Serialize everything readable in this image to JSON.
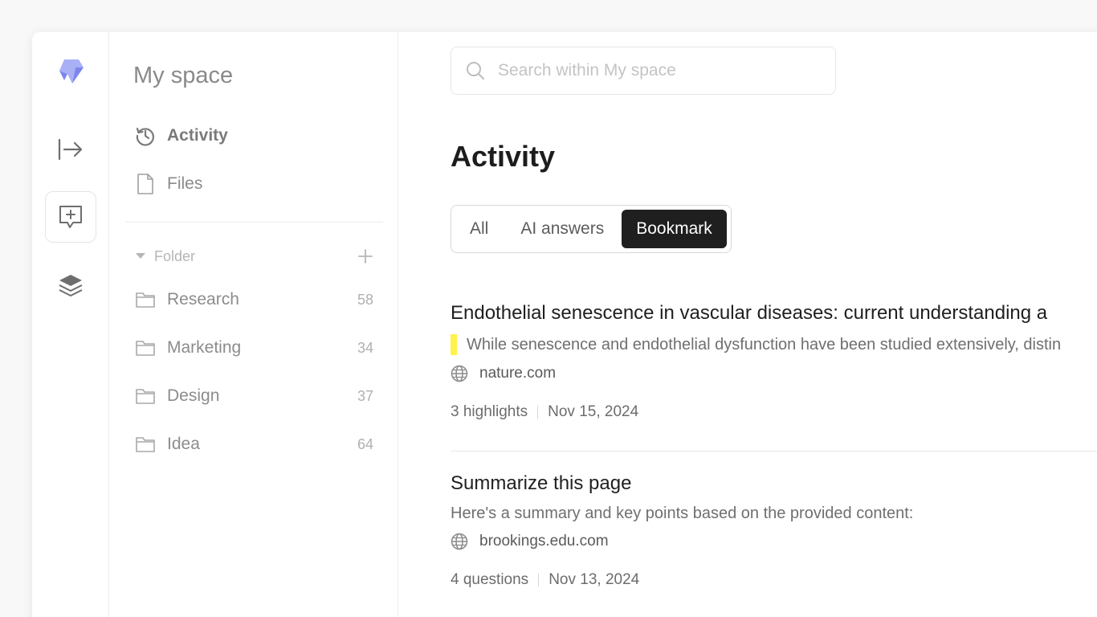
{
  "colors": {
    "accent": "#8d96f0",
    "highlight": "#fff24a",
    "tab_active_bg": "#1f1f1f"
  },
  "rail": {
    "items": [
      {
        "icon": "logo-icon"
      },
      {
        "icon": "expand-sidebar-icon"
      },
      {
        "icon": "new-chat-icon",
        "active": true
      },
      {
        "icon": "layers-icon"
      }
    ]
  },
  "sidebar": {
    "title": "My space",
    "nav": [
      {
        "label": "Activity",
        "icon": "history-icon",
        "active": true
      },
      {
        "label": "Files",
        "icon": "file-icon"
      }
    ],
    "folder_header": "Folder",
    "folders": [
      {
        "label": "Research",
        "count": "58"
      },
      {
        "label": "Marketing",
        "count": "34"
      },
      {
        "label": "Design",
        "count": "37"
      },
      {
        "label": "Idea",
        "count": "64"
      }
    ]
  },
  "search": {
    "placeholder": "Search within My space",
    "value": ""
  },
  "main": {
    "title": "Activity",
    "tabs": [
      {
        "label": "All"
      },
      {
        "label": "AI answers"
      },
      {
        "label": "Bookmark",
        "active": true
      }
    ],
    "cards": [
      {
        "title": "Endothelial senescence in vascular diseases: current understanding a",
        "snippet": "While senescence and endothelial dysfunction have been studied extensively, distin",
        "highlighted": true,
        "source": "nature.com",
        "stat": "3 highlights",
        "date": "Nov 15, 2024"
      },
      {
        "title": "Summarize this page",
        "snippet": "Here's a summary and key points based on the provided content:",
        "highlighted": false,
        "source": "brookings.edu.com",
        "stat": "4 questions",
        "date": "Nov 13, 2024"
      }
    ]
  }
}
